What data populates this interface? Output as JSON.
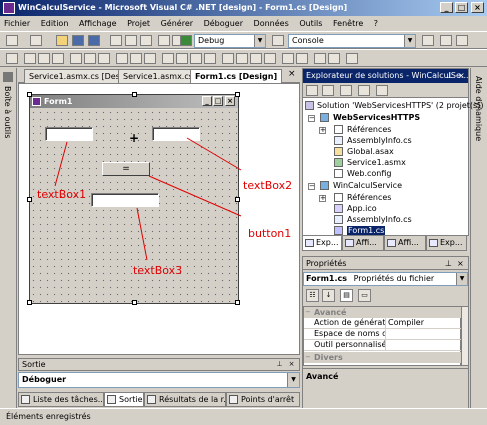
{
  "window": {
    "title": "WinCalculService - Microsoft Visual C# .NET [design] - Form1.cs [Design]"
  },
  "menu": [
    "Fichier",
    "Edition",
    "Affichage",
    "Projet",
    "Générer",
    "Déboguer",
    "Données",
    "Outils",
    "Fenêtre",
    "?"
  ],
  "toolbar": {
    "config_value": "Debug",
    "platform_value": "Console"
  },
  "left_dock": {
    "toolbox_label": "Boîte à outils"
  },
  "right_dock": {
    "help_label": "Aide dynamique"
  },
  "doc_tabs": [
    "Service1.asmx.cs [Design]",
    "Service1.asmx.cs",
    "Form1.cs [Design]"
  ],
  "doc_tabs_close": "×",
  "form": {
    "title": "Form1",
    "plus_label": "+",
    "button_text": "="
  },
  "annotations": {
    "textbox1": "textBox1",
    "textbox2": "textBox2",
    "button1": "button1",
    "textbox3": "textBox3"
  },
  "output": {
    "title": "Sortie",
    "selected": "Déboguer"
  },
  "bottom_tabs": [
    "Liste des tâches...",
    "Sortie",
    "Résultats de la r...",
    "Points d'arrêt"
  ],
  "status": {
    "text": "Éléments enregistrés"
  },
  "solution_explorer": {
    "title": "Explorateur de solutions - WinCalculSe...",
    "items": {
      "solution": "Solution 'WebServicesHTTPS' (2 projet(s))",
      "web_project": "WebServicesHTTPS",
      "web_refs": "Références",
      "web_assembly": "AssemblyInfo.cs",
      "global": "Global.asax",
      "service": "Service1.asmx",
      "webconfig": "Web.config",
      "win_project": "WinCalculService",
      "win_refs": "Références",
      "app_ico": "App.ico",
      "win_assembly": "AssemblyInfo.cs",
      "form1": "Form1.cs"
    },
    "tabs": [
      "Exp...",
      "Affi...",
      "Affi...",
      "Exp..."
    ]
  },
  "properties": {
    "title": "Propriétés",
    "object_name": "Form1.cs",
    "object_type": "Propriétés du fichier",
    "category_advanced": "Avancé",
    "rows": [
      {
        "name": "Action de génération",
        "value": "Compiler"
      },
      {
        "name": "Espace de noms de",
        "value": ""
      },
      {
        "name": "Outil personnalisé",
        "value": ""
      }
    ],
    "category_misc": "Divers",
    "description": "Avancé"
  }
}
